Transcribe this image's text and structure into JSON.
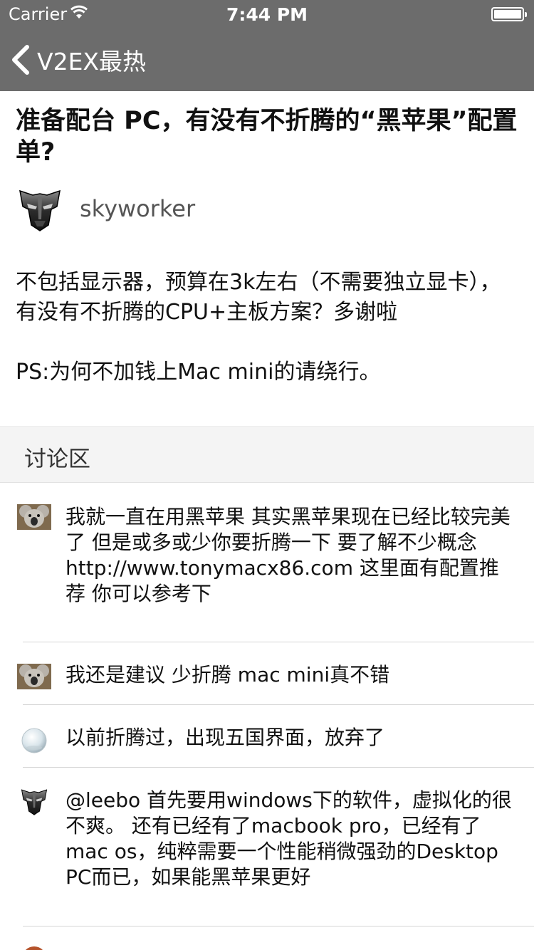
{
  "status_bar": {
    "carrier": "Carrier",
    "time": "7:44 PM"
  },
  "nav": {
    "back_label": "V2EX最热"
  },
  "post": {
    "title": "准备配台 PC，有没有不折腾的“黑苹果”配置单?",
    "author": "skyworker",
    "body": [
      "不包括显示器，预算在3k左右（不需要独立显卡），有没有不折腾的CPU+主板方案？多谢啦",
      "PS:为何不加钱上Mac mini的请绕行。"
    ]
  },
  "discussion": {
    "label": "讨论区",
    "replies": [
      {
        "avatar": "koala-avatar",
        "text": "我就一直在用黑苹果 其实黑苹果现在已经比较完美了 但是或多或少你要折腾一下  要了解不少概念 http://www.tonymacx86.com 这里面有配置推荐 你可以参考下"
      },
      {
        "avatar": "koala-avatar",
        "text": "我还是建议 少折腾 mac mini真不错"
      },
      {
        "avatar": "orb-avatar",
        "text": "以前折腾过，出现五国界面，放弃了"
      },
      {
        "avatar": "transformer-avatar",
        "text": "@leebo 首先要用windows下的软件，虚拟化的很不爽。 还有已经有了macbook pro，已经有了mac os，纯粹需要一个性能稍微强劲的Desktop PC而已，如果能黑苹果更好"
      }
    ]
  }
}
